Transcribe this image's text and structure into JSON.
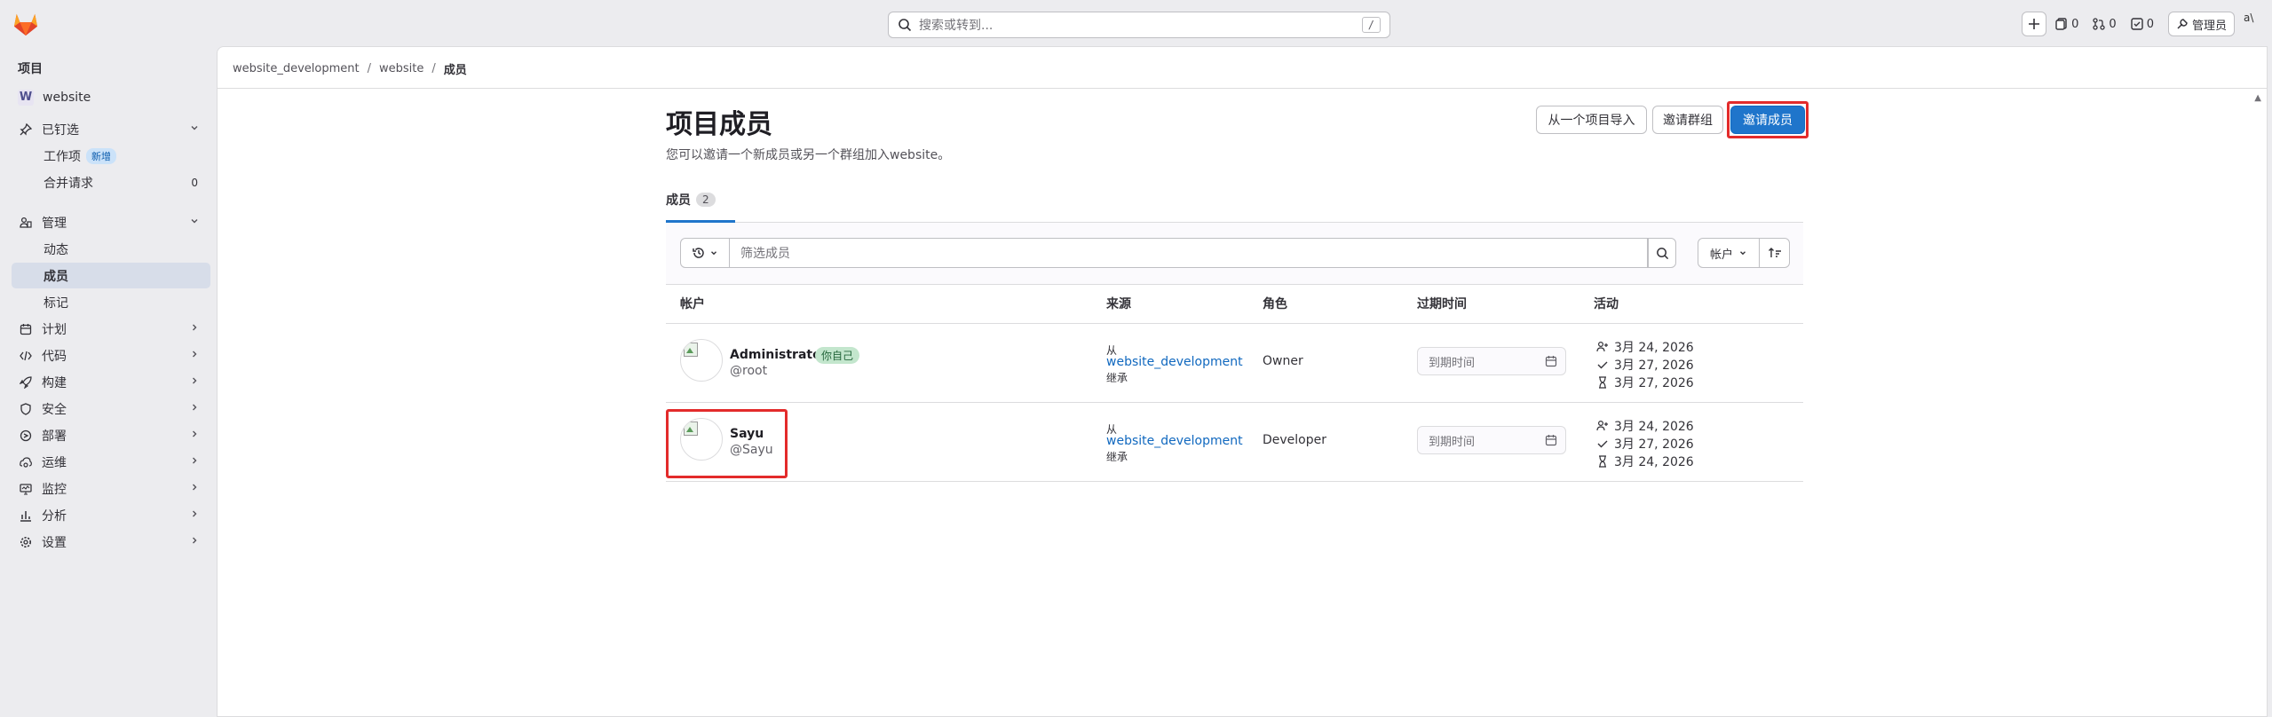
{
  "topbar": {
    "search_placeholder": "搜索或转到...",
    "search_shortcut": "/",
    "issues_count": "0",
    "mr_count": "0",
    "todo_count": "0",
    "admin_label": "管理员",
    "avatar_alt": "a\\"
  },
  "sidebar": {
    "section_title": "项目",
    "project_letter": "W",
    "project_name": "website",
    "pinned_label": "已钉选",
    "pinned_items": [
      {
        "label": "工作项",
        "badge": "新增"
      },
      {
        "label": "合并请求",
        "count": "0"
      }
    ],
    "manage_label": "管理",
    "manage_items": [
      {
        "label": "动态"
      },
      {
        "label": "成员"
      },
      {
        "label": "标记"
      }
    ],
    "nav_items": [
      {
        "label": "计划"
      },
      {
        "label": "代码"
      },
      {
        "label": "构建"
      },
      {
        "label": "安全"
      },
      {
        "label": "部署"
      },
      {
        "label": "运维"
      },
      {
        "label": "监控"
      },
      {
        "label": "分析"
      },
      {
        "label": "设置"
      }
    ]
  },
  "breadcrumb": {
    "group": "website_development",
    "project": "website",
    "current": "成员"
  },
  "page": {
    "title": "项目成员",
    "description": "您可以邀请一个新成员或另一个群组加入website。",
    "import_button": "从一个项目导入",
    "invite_group_button": "邀请群组",
    "invite_member_button": "邀请成员",
    "tab_label": "成员",
    "tab_count": "2",
    "filter_placeholder": "筛选成员",
    "sort_label": "帐户"
  },
  "table": {
    "headers": [
      "帐户",
      "来源",
      "角色",
      "过期时间",
      "活动"
    ],
    "rows": [
      {
        "name": "Administrator",
        "username": "@root",
        "you_badge": "你自己",
        "source_prefix": "从",
        "source_link": "website_development",
        "source_suffix": "继承",
        "role": "Owner",
        "expiry_placeholder": "到期时间",
        "activity": [
          "3月 24, 2026",
          "3月 27, 2026",
          "3月 27, 2026"
        ]
      },
      {
        "name": "Sayu",
        "username": "@Sayu",
        "source_prefix": "从",
        "source_link": "website_development",
        "source_suffix": "继承",
        "role": "Developer",
        "expiry_placeholder": "到期时间",
        "activity": [
          "3月 24, 2026",
          "3月 27, 2026",
          "3月 24, 2026"
        ]
      }
    ]
  },
  "colors": {
    "primary": "#1f75cb",
    "highlight_box": "#e32b2b",
    "link": "#1068bf"
  }
}
